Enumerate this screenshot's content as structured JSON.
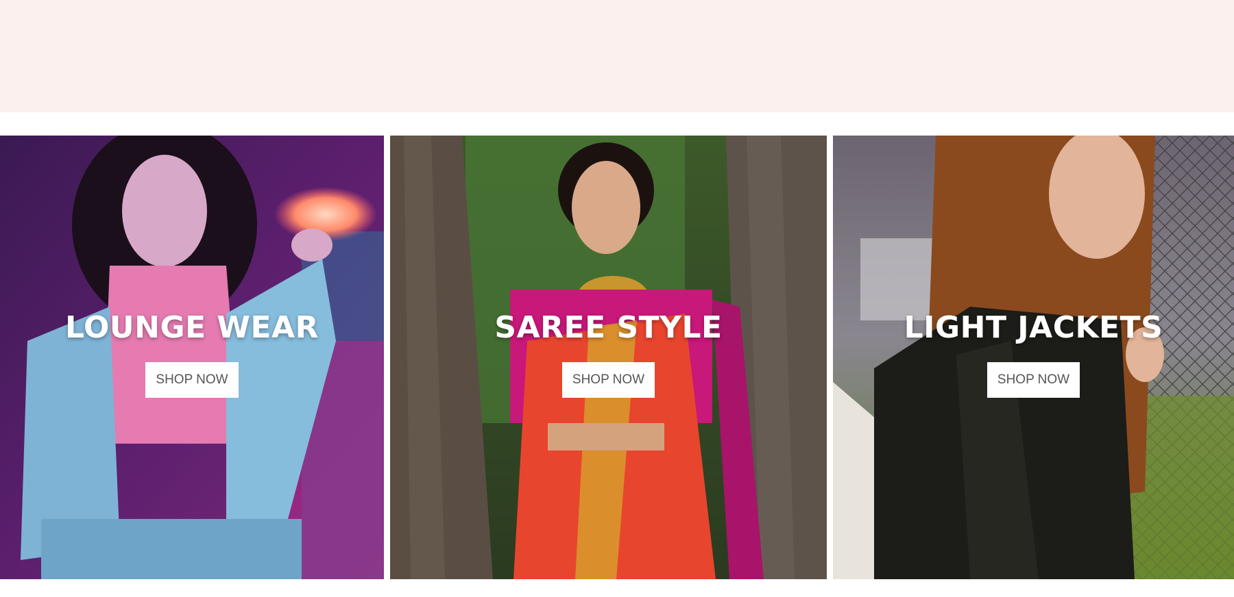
{
  "banner": {
    "background": "#fcf0ee"
  },
  "collections": [
    {
      "title": "LOUNGE WEAR",
      "cta": "SHOP NOW",
      "photo": "woman-denim-jacket-neon-photo"
    },
    {
      "title": "SAREE STYLE",
      "cta": "SHOP NOW",
      "photo": "woman-saree-tree-photo"
    },
    {
      "title": "LIGHT JACKETS",
      "cta": "SHOP NOW",
      "photo": "woman-leather-jacket-fence-photo"
    }
  ],
  "colors": {
    "title_text": "#ffffff",
    "button_bg": "#ffffff",
    "button_text": "#555555"
  }
}
